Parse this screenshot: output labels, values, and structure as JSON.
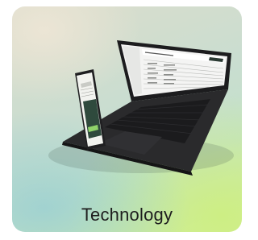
{
  "card": {
    "label": "Technology",
    "icon": "laptop-and-phone-illustration"
  }
}
